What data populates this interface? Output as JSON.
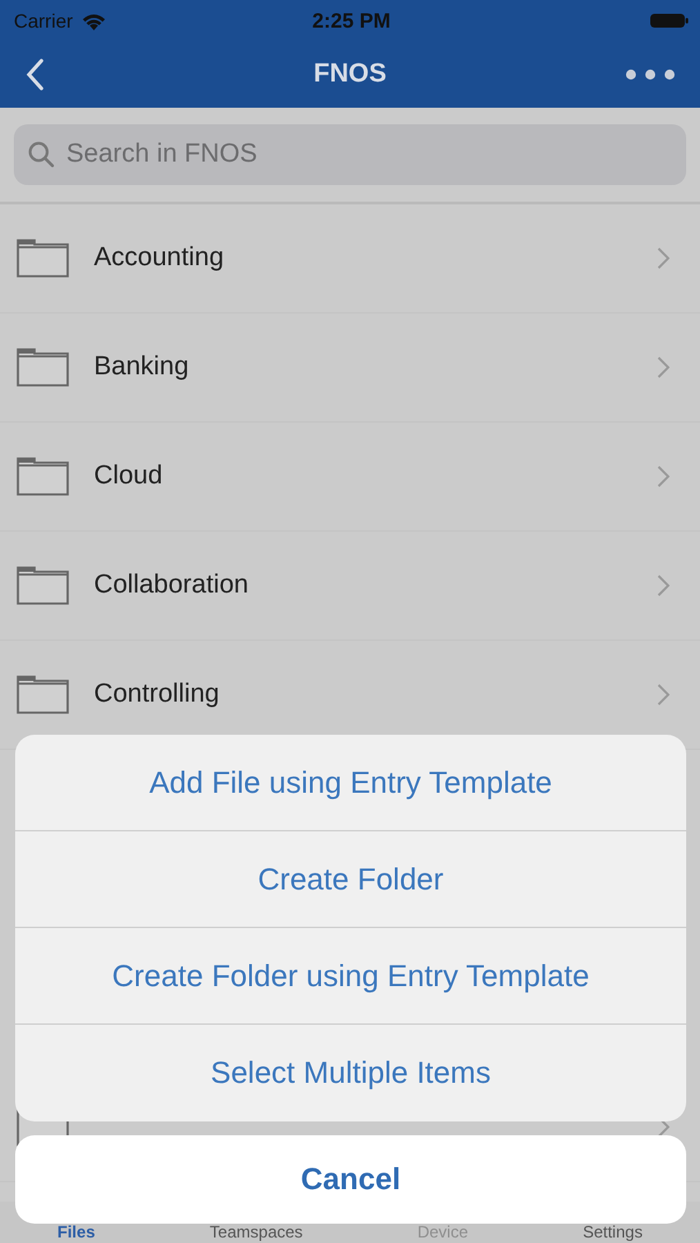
{
  "status_bar": {
    "carrier": "Carrier",
    "time": "2:25 PM"
  },
  "nav_bar": {
    "title": "FNOS"
  },
  "search": {
    "placeholder": "Search in FNOS"
  },
  "folders": [
    {
      "name": "Accounting"
    },
    {
      "name": "Banking"
    },
    {
      "name": "Cloud"
    },
    {
      "name": "Collaboration"
    },
    {
      "name": "Controlling"
    }
  ],
  "tabs": [
    {
      "label": "Files",
      "selected": true,
      "disabled": false
    },
    {
      "label": "Teamspaces",
      "selected": false,
      "disabled": false
    },
    {
      "label": "Device",
      "selected": false,
      "disabled": true
    },
    {
      "label": "Settings",
      "selected": false,
      "disabled": false
    }
  ],
  "action_sheet": {
    "actions": [
      "Add File using Entry Template",
      "Create Folder",
      "Create Folder using Entry Template",
      "Select Multiple Items"
    ],
    "cancel": "Cancel"
  }
}
